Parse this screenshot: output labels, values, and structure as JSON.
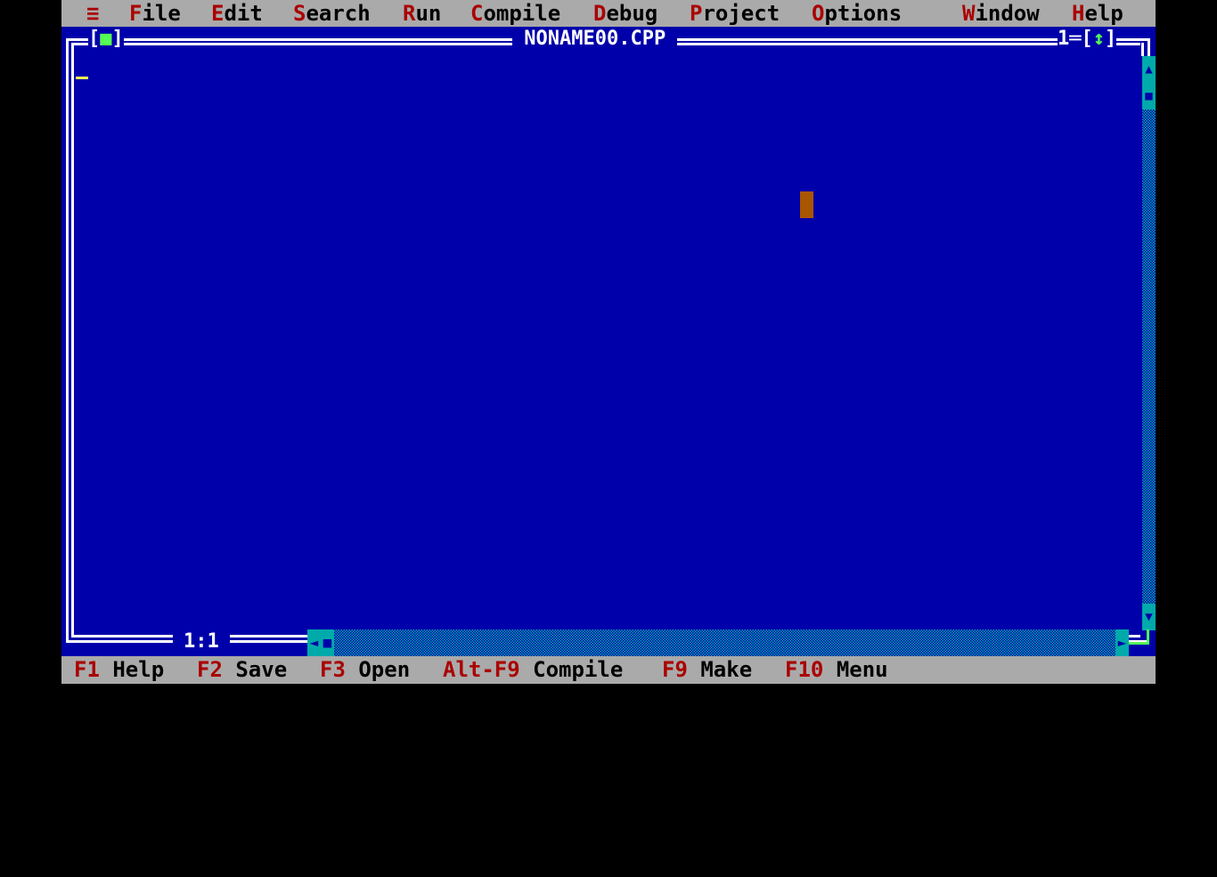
{
  "menubar": {
    "system_menu": "≡",
    "items": [
      {
        "hot": "F",
        "rest": "ile"
      },
      {
        "hot": "E",
        "rest": "dit"
      },
      {
        "hot": "S",
        "rest": "earch"
      },
      {
        "hot": "R",
        "rest": "un"
      },
      {
        "hot": "C",
        "rest": "ompile"
      },
      {
        "hot": "D",
        "rest": "ebug"
      },
      {
        "hot": "P",
        "rest": "roject"
      },
      {
        "hot": "O",
        "rest": "ptions"
      },
      {
        "hot": "W",
        "rest": "indow"
      },
      {
        "hot": "H",
        "rest": "elp"
      }
    ]
  },
  "editor": {
    "title": "NONAME00.CPP",
    "window_number": "1",
    "close_glyph": "■",
    "zoom_glyph": "↕",
    "cursor_position": "1:1",
    "content": ""
  },
  "scrollbars": {
    "up_glyph": "▲",
    "down_glyph": "▼",
    "left_glyph": "◄",
    "right_glyph": "►",
    "thumb_glyph": "■"
  },
  "statusbar": {
    "items": [
      {
        "key": "F1",
        "label": "Help"
      },
      {
        "key": "F2",
        "label": "Save"
      },
      {
        "key": "F3",
        "label": "Open"
      },
      {
        "key": "Alt-F9",
        "label": "Compile"
      },
      {
        "key": "F9",
        "label": "Make"
      },
      {
        "key": "F10",
        "label": "Menu"
      }
    ]
  },
  "colors": {
    "desktop_blue": "#0000aa",
    "menu_gray": "#aaaaaa",
    "hotkey_red": "#aa0000",
    "scroll_cyan": "#00aaaa",
    "accent_green": "#55ff55",
    "cursor_yellow": "#ffff55",
    "mouse_orange": "#aa5500"
  }
}
